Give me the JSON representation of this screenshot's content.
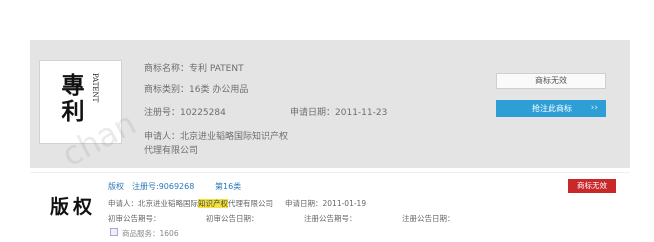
{
  "card1": {
    "logo_zh": "專利",
    "logo_en": "PATENT",
    "watermark": "chan",
    "name_label": "商标名称：",
    "name_value": "专利 PATENT",
    "class_label": "商标类别：",
    "class_value": "16类 办公用品",
    "reg_label": "注册号：",
    "reg_value": "10225284",
    "date_label": "申请日期：",
    "date_value": "2011-11-23",
    "applicant_label": "申请人：",
    "applicant_line1": "北京进业韬略国际知识产权",
    "applicant_line2": "代理有限公司",
    "status_button": "商标无效",
    "watch_button": "抢注此商标",
    "watch_chevron": "››",
    "colors": {
      "panel": "#e4e4e4",
      "accent": "#2e9fd6"
    }
  },
  "card2": {
    "logo": "版权",
    "tag_type": "版权",
    "tag_reg": "注册号:9069268",
    "tag_class": "第16类",
    "applicant_label": "申请人：",
    "applicant_pre": "北京进业韬略国际",
    "applicant_hl": "知识产权",
    "applicant_post": "代理有限公司",
    "date_label": "申请日期：",
    "date_value": "2011-01-19",
    "pub1_label": "初审公告期号：",
    "pub2_label": "初审公告日期：",
    "pub3_label": "注册公告期号：",
    "pub4_label": "注册公告日期：",
    "service_text": "商品服务：1606",
    "status_badge": "商标无效",
    "colors": {
      "badge": "#c9282b",
      "highlight": "#f5e23a",
      "link": "#2a78b8"
    }
  }
}
